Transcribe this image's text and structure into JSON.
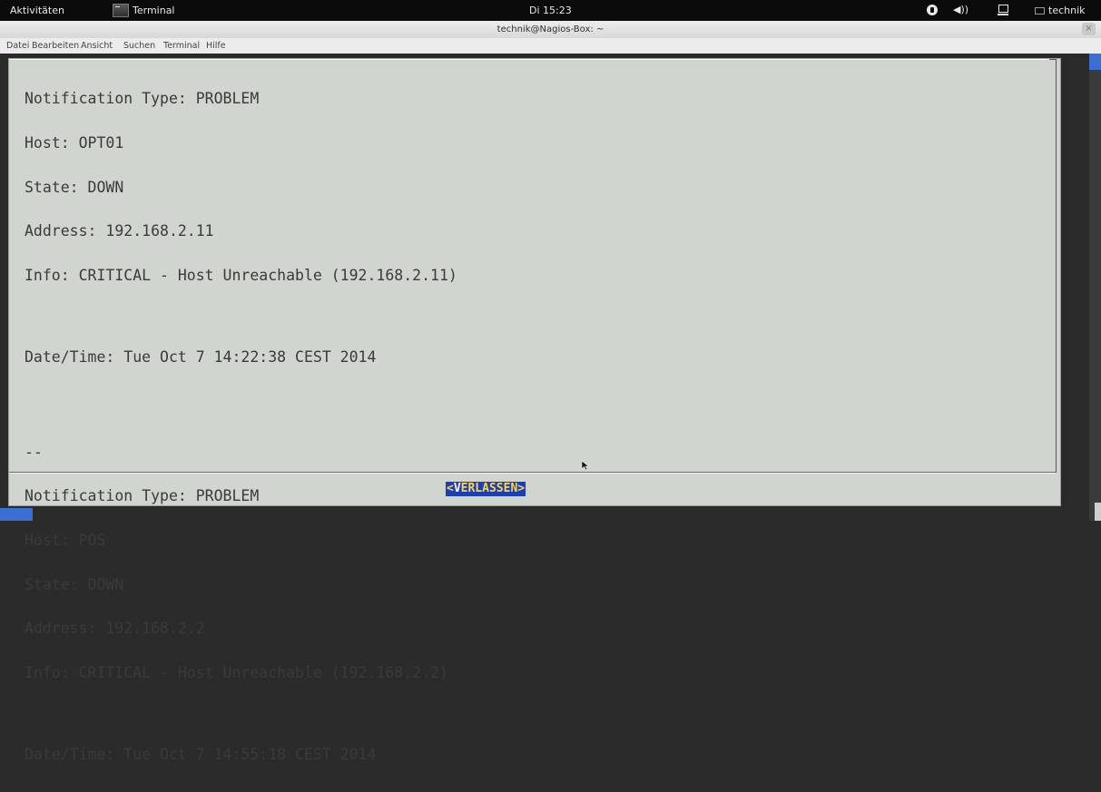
{
  "topbar": {
    "activities": "Aktivitäten",
    "app_name": "Terminal",
    "clock": "Di 15:23",
    "volume_glyph": "◀))",
    "user": "technik"
  },
  "window": {
    "title": "technik@Nagios-Box: ~",
    "close_glyph": "×"
  },
  "menu": {
    "items": [
      "Datei",
      "Bearbeiten",
      "Ansicht",
      "Suchen",
      "Terminal",
      "Hilfe"
    ]
  },
  "message": {
    "block1": {
      "type": "Notification Type: PROBLEM",
      "host": "Host: OPT01",
      "state": "State: DOWN",
      "address": "Address: 192.168.2.11",
      "info": "Info: CRITICAL - Host Unreachable (192.168.2.11)",
      "datetime": "Date/Time: Tue Oct 7 14:22:38 CEST 2014"
    },
    "separator": "--",
    "block2": {
      "type": "Notification Type: PROBLEM",
      "host": "Host: POS",
      "state": "State: DOWN",
      "address": "Address: 192.168.2.2",
      "info": "Info: CRITICAL - Host Unreachable (192.168.2.2)",
      "datetime": "Date/Time: Tue Oct 7 14:55:18 CEST 2014"
    }
  },
  "dialog": {
    "exit_open": "<",
    "exit_hotkey": "V",
    "exit_rest": "ERLASSEN",
    "exit_close": ">"
  },
  "colors": {
    "dialog_bg": "#d1d5cf",
    "button_bg": "#1b3fb8",
    "button_fg": "#ffd54a",
    "scroll_thumb": "#3b6fd4"
  }
}
